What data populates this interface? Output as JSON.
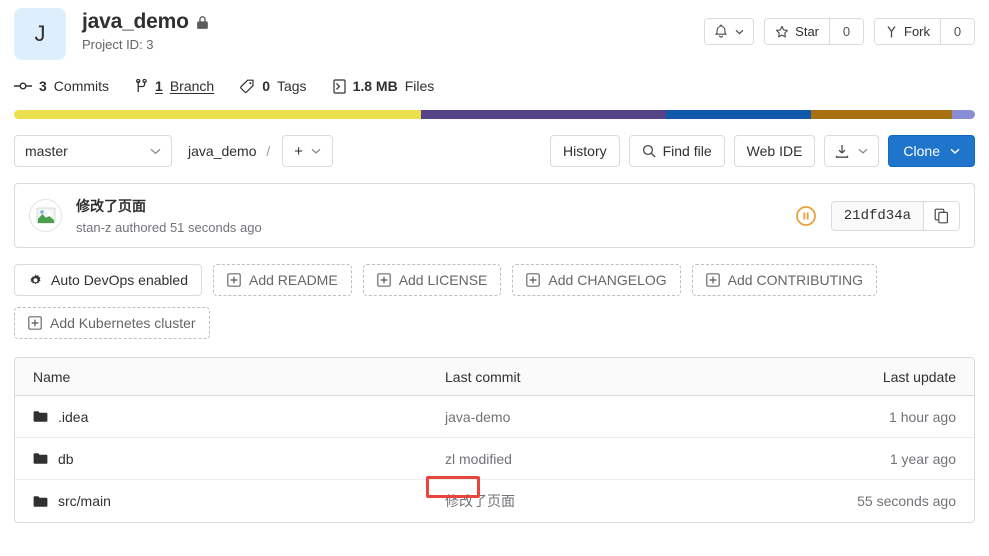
{
  "project": {
    "avatar_letter": "J",
    "name": "java_demo",
    "visibility_icon": "lock-icon",
    "project_id_label": "Project ID: 3"
  },
  "header_actions": {
    "notifications_icon": "bell-icon",
    "star_label": "Star",
    "star_count": "0",
    "fork_label": "Fork",
    "fork_count": "0"
  },
  "stats": [
    {
      "icon": "commit-icon",
      "value": "3",
      "label": "Commits",
      "link": false
    },
    {
      "icon": "branch-icon",
      "value": "1",
      "label": "Branch",
      "link": true
    },
    {
      "icon": "tag-icon",
      "value": "0",
      "label": "Tags",
      "link": false
    },
    {
      "icon": "file-icon",
      "value": "1.8 MB",
      "label": "Files",
      "link": false
    }
  ],
  "language_bar": [
    {
      "name": "segment-1",
      "color": "#ede04f",
      "width": "42.3%"
    },
    {
      "name": "segment-2",
      "color": "#564286",
      "width": "25.5%"
    },
    {
      "name": "segment-3",
      "color": "#1059aa",
      "width": "15.1%"
    },
    {
      "name": "segment-4",
      "color": "#a87010",
      "width": "14.7%"
    },
    {
      "name": "segment-5",
      "color": "#8b8cd6",
      "width": "2.4%"
    }
  ],
  "controls": {
    "branch": "master",
    "breadcrumb_root": "java_demo",
    "breadcrumb_sep": "/",
    "plus_label": "+",
    "history_label": "History",
    "find_file_label": "Find file",
    "web_ide_label": "Web IDE",
    "clone_label": "Clone",
    "clone_color": "#1f75cb"
  },
  "commit": {
    "title": "修改了页面",
    "author_line": "stan-z authored 51 seconds ago",
    "pipeline_status": "pipeline-pending-icon",
    "pipeline_color": "#e9a13b",
    "sha": "21dfd34a",
    "copy_icon": "copy-icon"
  },
  "quick_actions": {
    "row1": [
      {
        "label": "Auto DevOps enabled",
        "icon": "gear-icon",
        "dashed": false
      },
      {
        "label": "Add README",
        "icon": "plus-square-icon",
        "dashed": true
      },
      {
        "label": "Add LICENSE",
        "icon": "plus-square-icon",
        "dashed": true
      },
      {
        "label": "Add CHANGELOG",
        "icon": "plus-square-icon",
        "dashed": true
      },
      {
        "label": "Add CONTRIBUTING",
        "icon": "plus-square-icon",
        "dashed": true
      }
    ],
    "row2": [
      {
        "label": "Add Kubernetes cluster",
        "icon": "plus-square-icon",
        "dashed": true
      }
    ]
  },
  "file_table": {
    "columns": {
      "name": "Name",
      "last_commit": "Last commit",
      "last_update": "Last update"
    },
    "rows": [
      {
        "name": ".idea",
        "last_commit": "java-demo",
        "last_update": "1 hour ago",
        "highlight": false
      },
      {
        "name": "db",
        "last_commit": "zl modified",
        "last_update": "1 year ago",
        "highlight": false
      },
      {
        "name": "src/main",
        "last_commit": "修改了页面",
        "last_update": "55 seconds ago",
        "highlight": true
      }
    ]
  },
  "annotation": {
    "box_color": "#e8453c"
  }
}
